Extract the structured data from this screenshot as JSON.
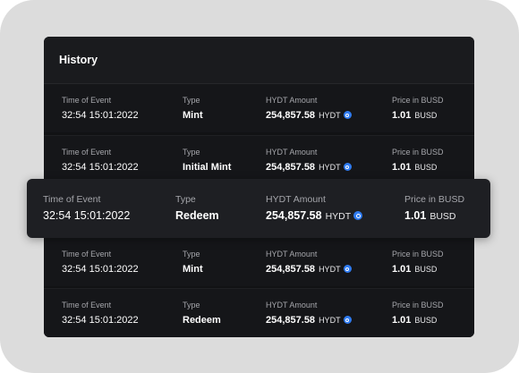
{
  "history": {
    "title": "History",
    "columns": {
      "time": "Time of Event",
      "type": "Type",
      "amount": "HYDT Amount",
      "price": "Price in BUSD"
    },
    "rows": [
      {
        "time": "32:54 15:01:2022",
        "type": "Mint",
        "amount": "254,857.58",
        "amount_unit": "HYDT",
        "price": "1.01",
        "price_unit": "BUSD"
      },
      {
        "time": "32:54 15:01:2022",
        "type": "Initial Mint",
        "amount": "254,857.58",
        "amount_unit": "HYDT",
        "price": "1.01",
        "price_unit": "BUSD"
      },
      {
        "time": "32:54 15:01:2022",
        "type": "Redeem",
        "amount": "254,857.58",
        "amount_unit": "HYDT",
        "price": "1.01",
        "price_unit": "BUSD"
      },
      {
        "time": "32:54 15:01:2022",
        "type": "Mint",
        "amount": "254,857.58",
        "amount_unit": "HYDT",
        "price": "1.01",
        "price_unit": "BUSD"
      },
      {
        "time": "32:54 15:01:2022",
        "type": "Redeem",
        "amount": "254,857.58",
        "amount_unit": "HYDT",
        "price": "1.01",
        "price_unit": "BUSD"
      }
    ]
  },
  "icons": {
    "hydt_token": "hydt-token-icon"
  },
  "colors": {
    "panel_bg": "#111214",
    "header_bg": "#1a1b1e",
    "highlight_bg": "#1e1f23",
    "token_blue": "#2f7bf0",
    "label_gray": "#a5a6ab"
  }
}
